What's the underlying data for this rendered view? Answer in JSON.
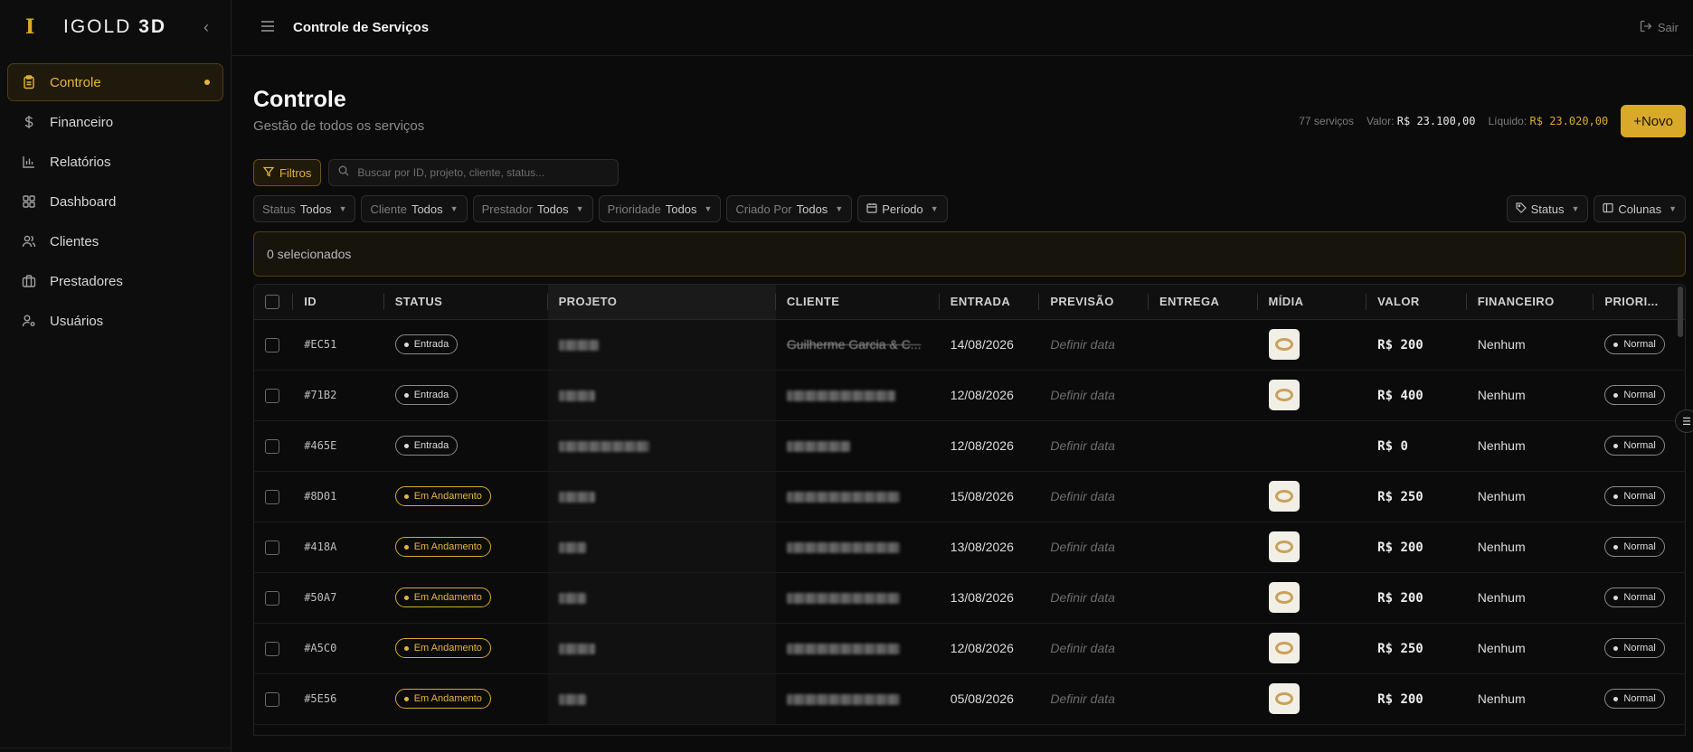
{
  "brand": {
    "name_light": "IGOLD",
    "name_bold": "3D"
  },
  "sidebar": {
    "items": [
      {
        "label": "Controle",
        "icon": "clipboard-icon"
      },
      {
        "label": "Financeiro",
        "icon": "dollar-icon"
      },
      {
        "label": "Relatórios",
        "icon": "bar-chart-icon"
      },
      {
        "label": "Dashboard",
        "icon": "grid-icon"
      },
      {
        "label": "Clientes",
        "icon": "users-icon"
      },
      {
        "label": "Prestadores",
        "icon": "briefcase-icon"
      },
      {
        "label": "Usuários",
        "icon": "user-cog-icon"
      }
    ]
  },
  "topbar": {
    "title": "Controle de Serviços",
    "logout": "Sair"
  },
  "page": {
    "title": "Controle",
    "subtitle": "Gestão de todos os serviços",
    "count": "77 serviços",
    "valor_label": "Valor:",
    "valor": "R$ 23.100,00",
    "liquido_label": "Líquido:",
    "liquido": "R$ 23.020,00",
    "new_button": "+Novo"
  },
  "toolbar": {
    "filter_label": "Filtros",
    "search_placeholder": "Buscar por ID, projeto, cliente, status..."
  },
  "filters": [
    {
      "label": "Status",
      "value": "Todos"
    },
    {
      "label": "Cliente",
      "value": "Todos"
    },
    {
      "label": "Prestador",
      "value": "Todos"
    },
    {
      "label": "Prioridade",
      "value": "Todos"
    },
    {
      "label": "Criado Por",
      "value": "Todos"
    }
  ],
  "period_label": "Período",
  "status_button": "Status",
  "columns_button": "Colunas",
  "selection": "0 selecionados",
  "table": {
    "headers": [
      "ID",
      "STATUS",
      "PROJETO",
      "CLIENTE",
      "ENTRADA",
      "PREVISÃO",
      "ENTREGA",
      "MÍDIA",
      "VALOR",
      "FINANCEIRO",
      "PRIORI..."
    ],
    "rows": [
      {
        "id": "#EC51",
        "status": "Entrada",
        "cliente": "Guilherme Garcia & C...",
        "entrada": "14/08/2026",
        "previsao": "Definir data",
        "valor": "R$ 200",
        "financeiro": "Nenhum",
        "prioridade": "Normal",
        "media": true
      },
      {
        "id": "#71B2",
        "status": "Entrada",
        "cliente": "",
        "entrada": "12/08/2026",
        "previsao": "Definir data",
        "valor": "R$ 400",
        "financeiro": "Nenhum",
        "prioridade": "Normal",
        "media": true
      },
      {
        "id": "#465E",
        "status": "Entrada",
        "cliente": "",
        "entrada": "12/08/2026",
        "previsao": "Definir data",
        "valor": "R$ 0",
        "financeiro": "Nenhum",
        "prioridade": "Normal",
        "media": false
      },
      {
        "id": "#8D01",
        "status": "Em Andamento",
        "cliente": "",
        "entrada": "15/08/2026",
        "previsao": "Definir data",
        "valor": "R$ 250",
        "financeiro": "Nenhum",
        "prioridade": "Normal",
        "media": true
      },
      {
        "id": "#418A",
        "status": "Em Andamento",
        "cliente": "",
        "entrada": "13/08/2026",
        "previsao": "Definir data",
        "valor": "R$ 200",
        "financeiro": "Nenhum",
        "prioridade": "Normal",
        "media": true
      },
      {
        "id": "#50A7",
        "status": "Em Andamento",
        "cliente": "",
        "entrada": "13/08/2026",
        "previsao": "Definir data",
        "valor": "R$ 200",
        "financeiro": "Nenhum",
        "prioridade": "Normal",
        "media": true
      },
      {
        "id": "#A5C0",
        "status": "Em Andamento",
        "cliente": "",
        "entrada": "12/08/2026",
        "previsao": "Definir data",
        "valor": "R$ 250",
        "financeiro": "Nenhum",
        "prioridade": "Normal",
        "media": true
      },
      {
        "id": "#5E56",
        "status": "Em Andamento",
        "cliente": "",
        "entrada": "05/08/2026",
        "previsao": "Definir data",
        "valor": "R$ 200",
        "financeiro": "Nenhum",
        "prioridade": "Normal",
        "media": true
      }
    ]
  }
}
